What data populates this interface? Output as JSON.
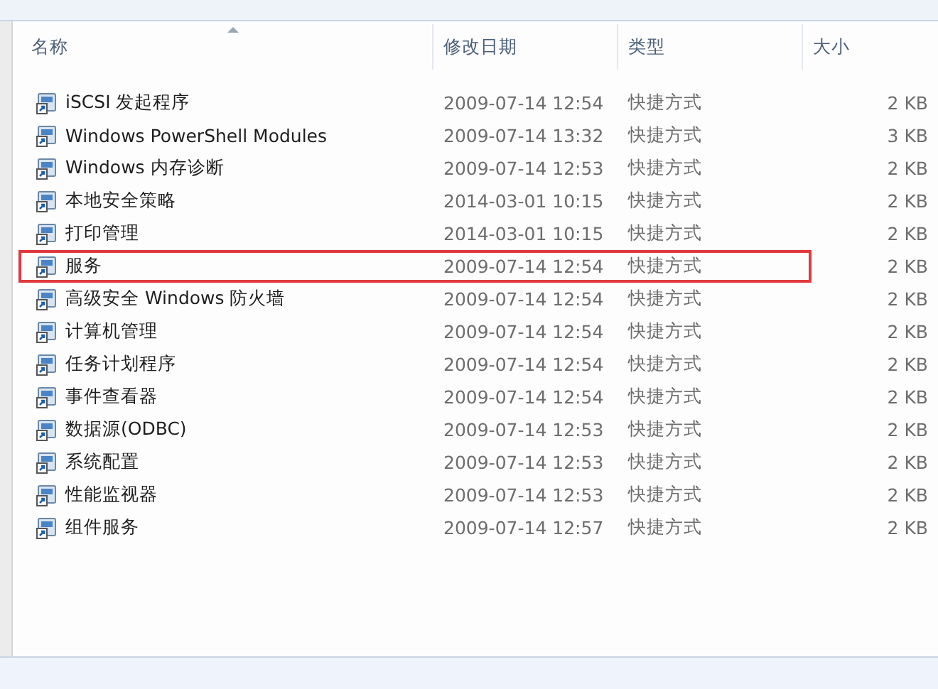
{
  "columns": [
    {
      "label": "名称",
      "sorted": true
    },
    {
      "label": "修改日期",
      "sorted": false
    },
    {
      "label": "类型",
      "sorted": false
    },
    {
      "label": "大小",
      "sorted": false
    }
  ],
  "rows": [
    {
      "name": "iSCSI 发起程序",
      "date": "2009-07-14 12:54",
      "type": "快捷方式",
      "size": "2 KB",
      "highlighted": false
    },
    {
      "name": "Windows PowerShell Modules",
      "date": "2009-07-14 13:32",
      "type": "快捷方式",
      "size": "3 KB",
      "highlighted": false
    },
    {
      "name": "Windows 内存诊断",
      "date": "2009-07-14 12:53",
      "type": "快捷方式",
      "size": "2 KB",
      "highlighted": false
    },
    {
      "name": "本地安全策略",
      "date": "2014-03-01 10:15",
      "type": "快捷方式",
      "size": "2 KB",
      "highlighted": false
    },
    {
      "name": "打印管理",
      "date": "2014-03-01 10:15",
      "type": "快捷方式",
      "size": "2 KB",
      "highlighted": false
    },
    {
      "name": "服务",
      "date": "2009-07-14 12:54",
      "type": "快捷方式",
      "size": "2 KB",
      "highlighted": true
    },
    {
      "name": "高级安全 Windows 防火墙",
      "date": "2009-07-14 12:54",
      "type": "快捷方式",
      "size": "2 KB",
      "highlighted": false
    },
    {
      "name": "计算机管理",
      "date": "2009-07-14 12:54",
      "type": "快捷方式",
      "size": "2 KB",
      "highlighted": false
    },
    {
      "name": "任务计划程序",
      "date": "2009-07-14 12:54",
      "type": "快捷方式",
      "size": "2 KB",
      "highlighted": false
    },
    {
      "name": "事件查看器",
      "date": "2009-07-14 12:54",
      "type": "快捷方式",
      "size": "2 KB",
      "highlighted": false
    },
    {
      "name": "数据源(ODBC)",
      "date": "2009-07-14 12:53",
      "type": "快捷方式",
      "size": "2 KB",
      "highlighted": false
    },
    {
      "name": "系统配置",
      "date": "2009-07-14 12:53",
      "type": "快捷方式",
      "size": "2 KB",
      "highlighted": false
    },
    {
      "name": "性能监视器",
      "date": "2009-07-14 12:53",
      "type": "快捷方式",
      "size": "2 KB",
      "highlighted": false
    },
    {
      "name": "组件服务",
      "date": "2009-07-14 12:57",
      "type": "快捷方式",
      "size": "2 KB",
      "highlighted": false
    }
  ]
}
